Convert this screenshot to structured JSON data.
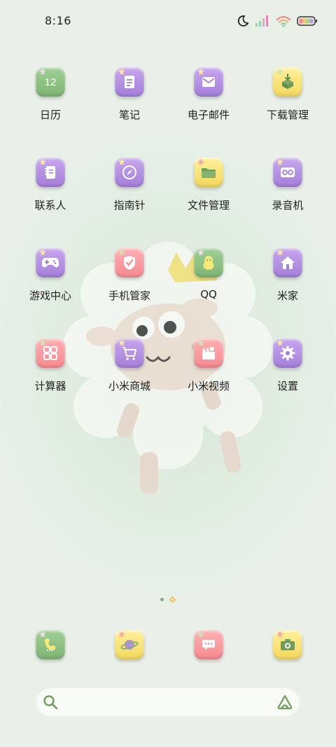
{
  "status": {
    "time": "8:16"
  },
  "apps": [
    {
      "label": "日历",
      "icon": "calendar-icon",
      "color": "#8fc286",
      "glyph": "12"
    },
    {
      "label": "笔记",
      "icon": "notes-icon",
      "color": "#b590e4"
    },
    {
      "label": "电子邮件",
      "icon": "email-icon",
      "color": "#b590e4"
    },
    {
      "label": "下载管理",
      "icon": "download-icon",
      "color": "#f9e474"
    },
    {
      "label": "联系人",
      "icon": "contacts-icon",
      "color": "#b590e4"
    },
    {
      "label": "指南针",
      "icon": "compass-icon",
      "color": "#b590e4"
    },
    {
      "label": "文件管理",
      "icon": "folder-icon",
      "color": "#f9e474"
    },
    {
      "label": "录音机",
      "icon": "recorder-icon",
      "color": "#b590e4"
    },
    {
      "label": "游戏中心",
      "icon": "gamepad-icon",
      "color": "#b590e4"
    },
    {
      "label": "手机管家",
      "icon": "shield-icon",
      "color": "#f79da2"
    },
    {
      "label": "QQ",
      "icon": "qq-penguin-icon",
      "color": "#8fc286"
    },
    {
      "label": "米家",
      "icon": "home-icon",
      "color": "#b590e4"
    },
    {
      "label": "计算器",
      "icon": "calculator-icon",
      "color": "#f79da2"
    },
    {
      "label": "小米商城",
      "icon": "cart-icon",
      "color": "#b590e4"
    },
    {
      "label": "小米视频",
      "icon": "clapperboard-icon",
      "color": "#f79da2"
    },
    {
      "label": "设置",
      "icon": "gear-icon",
      "color": "#b590e4"
    }
  ],
  "dock": [
    {
      "icon": "phone-icon",
      "color": "#8fc286"
    },
    {
      "icon": "browser-planet-icon",
      "color": "#f9e474"
    },
    {
      "icon": "messages-icon",
      "color": "#f79da2"
    },
    {
      "icon": "camera-icon",
      "color": "#f9e474"
    }
  ],
  "search": {
    "placeholder": ""
  }
}
